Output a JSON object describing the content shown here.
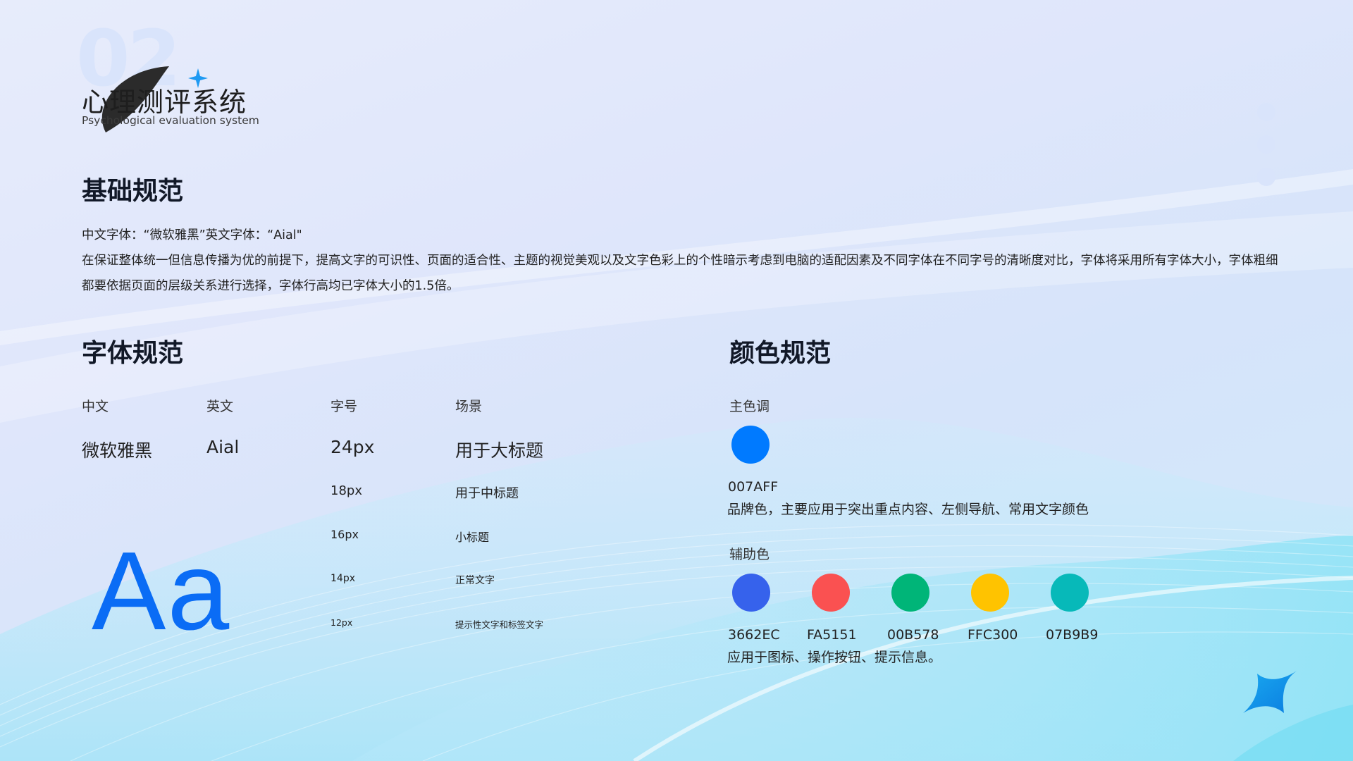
{
  "logo": {
    "number": "02",
    "title": "心理测评系统",
    "subtitle": "Psychological evaluation system"
  },
  "basic": {
    "heading": "基础规范",
    "fonts_line": "中文字体：“微软雅黑”英文字体：“Aial\"",
    "para_line1": "在保证整体统一但信息传播为优的前提下，提高文字的可识性、页面的适合性、主题的视觉美观以及文字色彩上的个性暗示考虑到电脑的适配因素及不同字体在不同字号的清晰度对比，字体将采用所有字体大小，字体粗细",
    "para_line2": "都要依据页面的层级关系进行选择，字体行高均已字体大小的1.5倍。"
  },
  "font_spec": {
    "heading": "字体规范",
    "headers": [
      "中文",
      "英文",
      "字号",
      "场景"
    ],
    "chinese_font": "微软雅黑",
    "english_font": "Aial",
    "rows": [
      {
        "size": "24px",
        "scene": "用于大标题"
      },
      {
        "size": "18px",
        "scene": "用于中标题"
      },
      {
        "size": "16px",
        "scene": "小标题"
      },
      {
        "size": "14px",
        "scene": "正常文字"
      },
      {
        "size": "12px",
        "scene": "提示性文字和标签文字"
      }
    ],
    "sample": "Aa"
  },
  "color_spec": {
    "heading": "颜色规范",
    "primary_label": "主色调",
    "primary": {
      "hex": "007AFF",
      "color": "#007AFF"
    },
    "primary_desc": "品牌色，主要应用于突出重点内容、左侧导航、常用文字颜色",
    "secondary_label": "辅助色",
    "secondary": [
      {
        "hex": "3662EC",
        "color": "#3662EC"
      },
      {
        "hex": "FA5151",
        "color": "#FA5151"
      },
      {
        "hex": "00B578",
        "color": "#00B578"
      },
      {
        "hex": "FFC300",
        "color": "#FFC300"
      },
      {
        "hex": "07B9B9",
        "color": "#07B9B9"
      }
    ],
    "secondary_desc": "应用于图标、操作按钮、提示信息。"
  }
}
